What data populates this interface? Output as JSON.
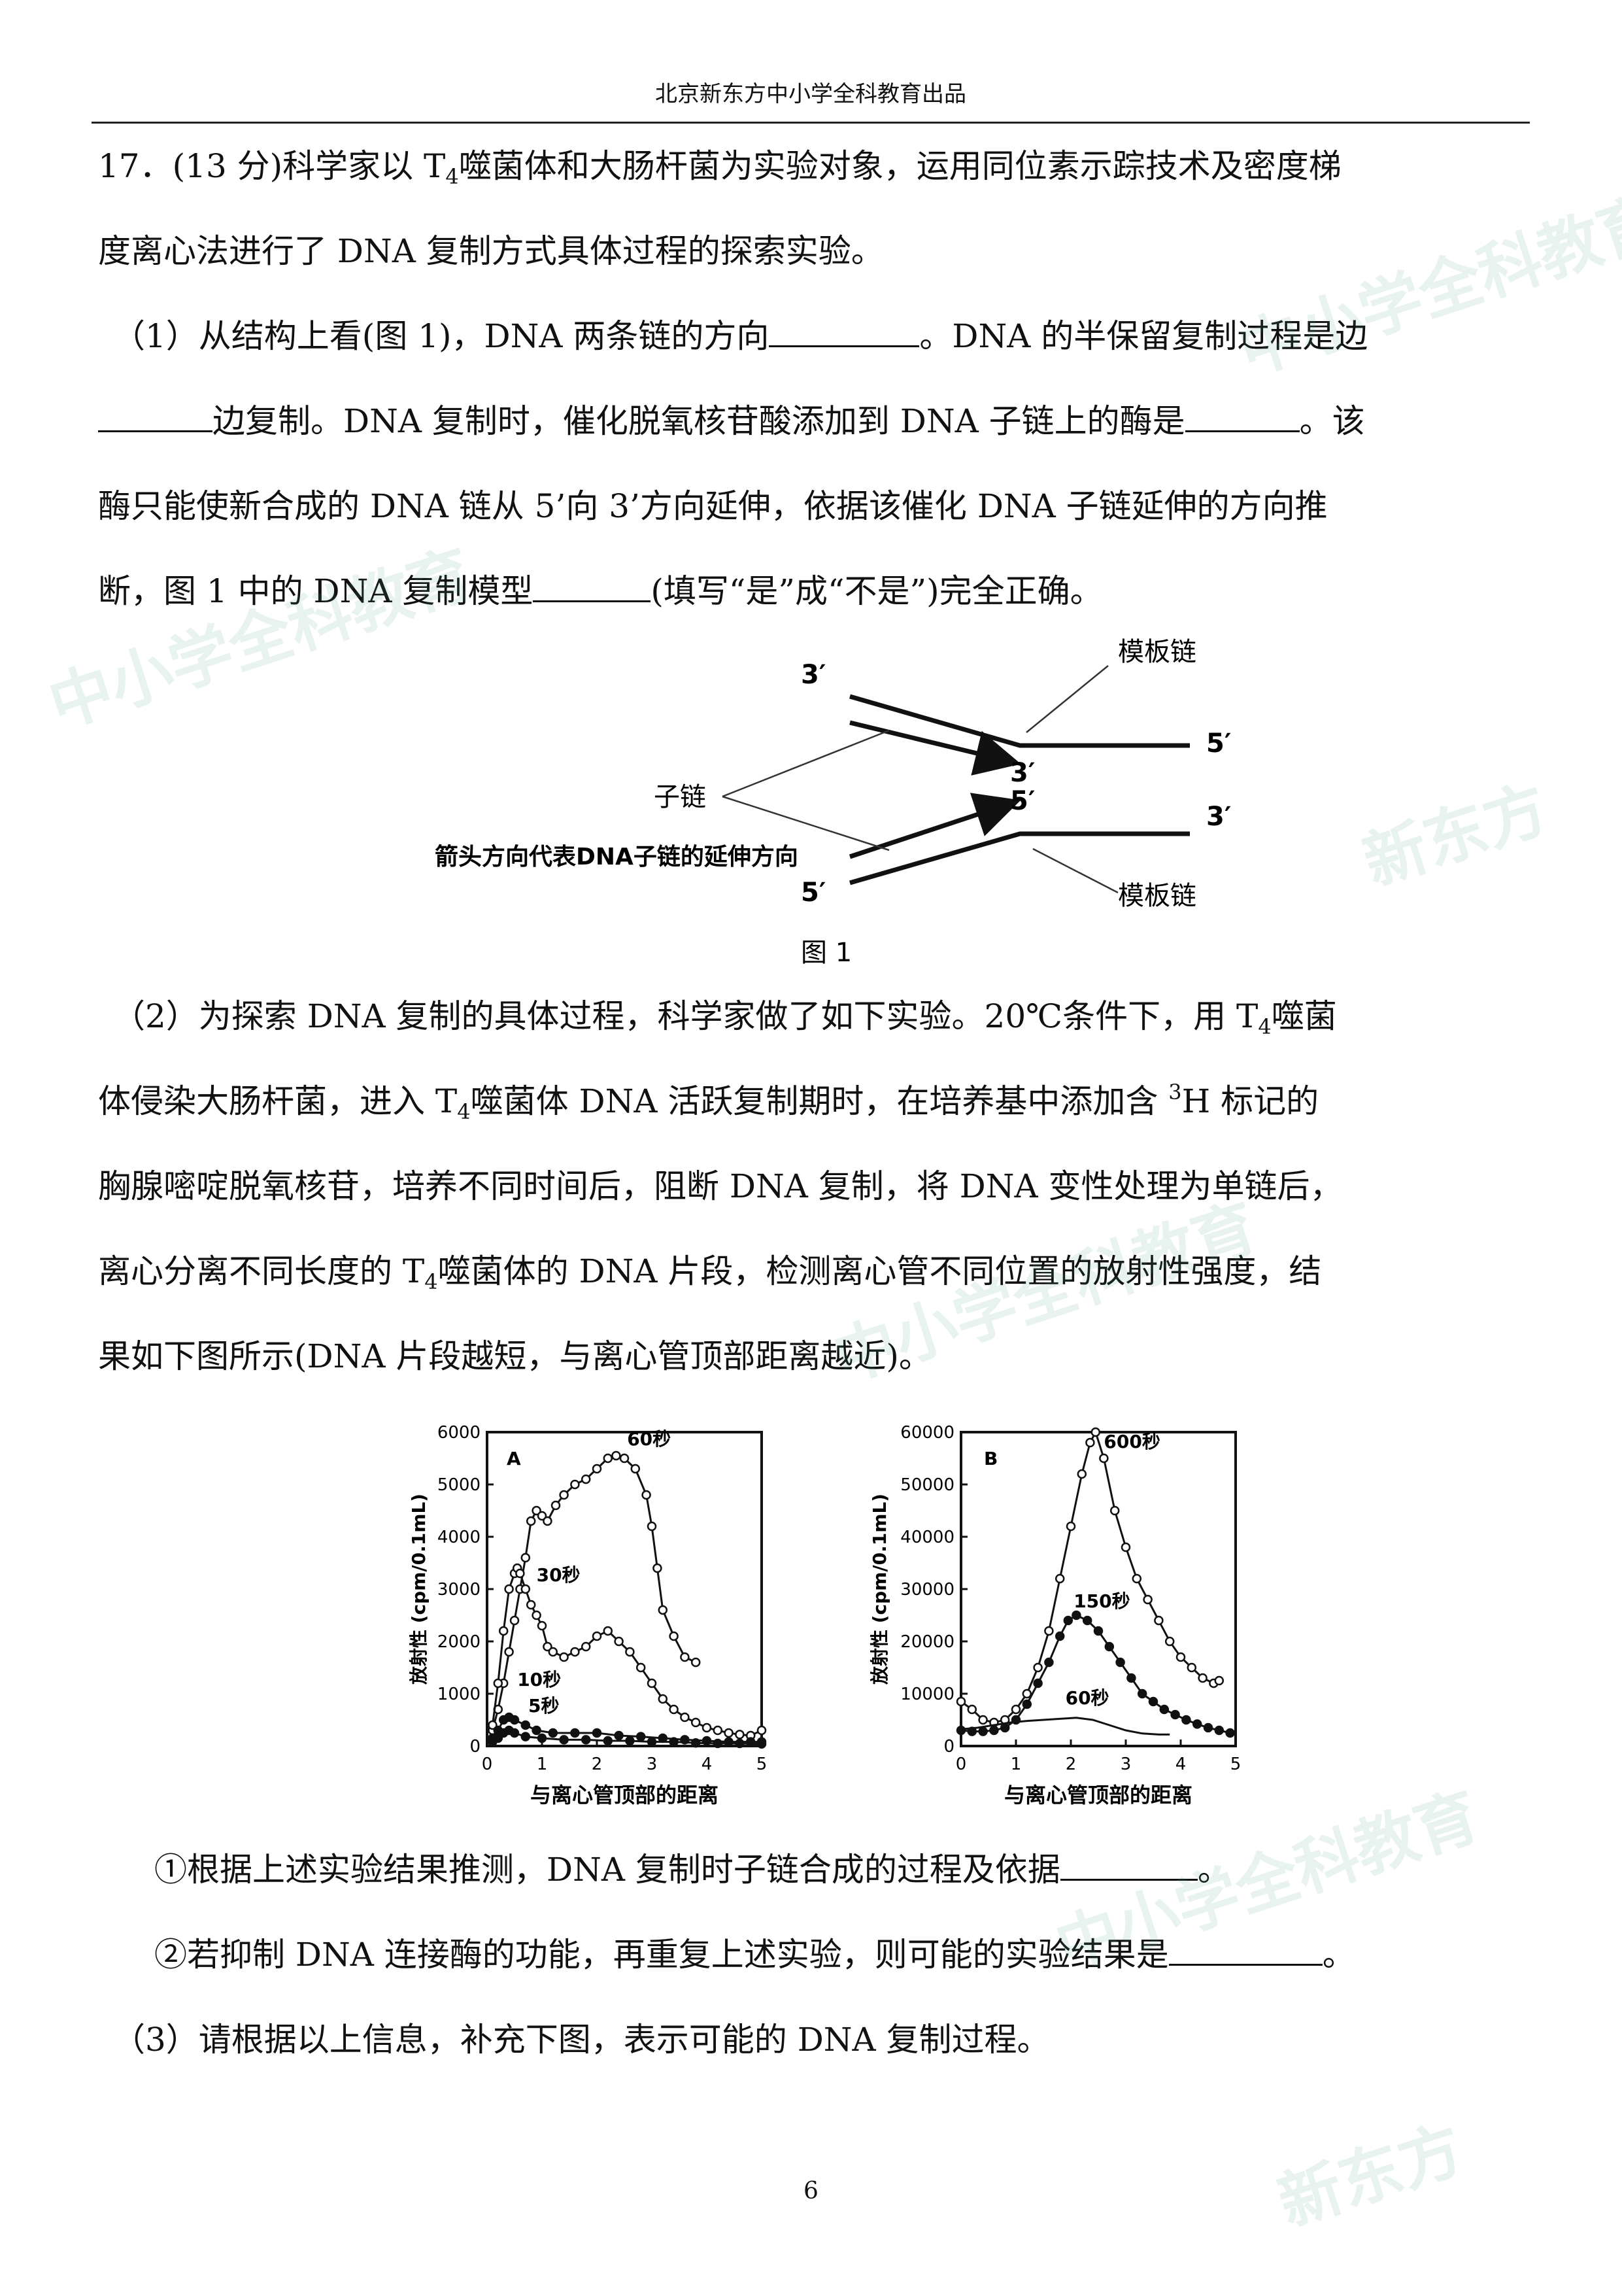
{
  "header": "北京新东方中小学全科教育出品",
  "question": {
    "title_prefix": "17．(13 分)科学家以 T",
    "title_sub": "4",
    "title_rest": "噬菌体和大肠杆菌为实验对象，运用同位素示踪技术及密度梯",
    "title_line2": "度离心法进行了 DNA 复制方式具体过程的探索实验。",
    "p1_l1a": "（1）从结构上看(图 1)，DNA 两条链的方向",
    "p1_l1b": "。DNA 的半保留复制过程是边",
    "p1_l2a": "边复制。DNA 复制时，催化脱氧核苷酸添加到 DNA 子链上的酶是",
    "p1_l2b": "。该",
    "p1_l3": "酶只能使新合成的 DNA 链从 5’向 3’方向延伸，依据该催化 DNA 子链延伸的方向推",
    "p1_l4a": "断，图 1 中的 DNA 复制模型",
    "p1_l4b": "(填写“是”成“不是”)完全正确。",
    "p2_l1a": "（2）为探索 DNA 复制的具体过程，科学家做了如下实验。20℃条件下，用 T",
    "p2_l1sub": "4",
    "p2_l1b": "噬菌",
    "p2_l2a": "体侵染大肠杆菌，进入 T",
    "p2_l2sub": "4",
    "p2_l2b": "噬菌体 DNA 活跃复制期时，在培养基中添加含 ",
    "p2_l2sup": "3",
    "p2_l2c": "H 标记的",
    "p2_l3": "胸腺嘧啶脱氧核苷，培养不同时间后，阻断 DNA 复制，将 DNA 变性处理为单链后，",
    "p2_l4a": "离心分离不同长度的 T",
    "p2_l4sub": "4",
    "p2_l4b": "噬菌体的 DNA 片段，检测离心管不同位置的放射性强度，结",
    "p2_l5": "果如下图所示(DNA 片段越短，与离心管顶部距离越近)。",
    "q1a": "①根据上述实验结果推测，DNA 复制时子链合成的过程及依据",
    "q1b": "。",
    "q2a": "②若抑制 DNA 连接酶的功能，再重复上述实验，则可能的实验结果是",
    "q2b": "。",
    "p3": "（3）请根据以上信息，补充下图，表示可能的 DNA 复制过程。"
  },
  "figure1": {
    "caption": "图 1",
    "labels": {
      "template_top": "模板链",
      "template_bottom": "模板链",
      "daughter": "子链",
      "arrow_note": "箭头方向代表DNA子链的延伸方向",
      "top_left": "3′",
      "inner_top": "3′",
      "right_top": "5′",
      "inner_bottom": "5′",
      "right_bottom": "3′",
      "bottom_left": "5′"
    }
  },
  "chart_data": [
    {
      "type": "line",
      "panel": "A",
      "xlabel": "与离心管顶部的距离",
      "ylabel": "放射性 (cpm/0.1mL)",
      "xlim": [
        0,
        5
      ],
      "ylim": [
        0,
        6000
      ],
      "xticks": [
        0,
        1,
        2,
        3,
        4,
        5
      ],
      "yticks": [
        0,
        1000,
        2000,
        3000,
        4000,
        5000,
        6000
      ],
      "series": [
        {
          "name": "60秒",
          "marker": "open-circle",
          "points": [
            [
              0.1,
              300
            ],
            [
              0.2,
              700
            ],
            [
              0.3,
              1200
            ],
            [
              0.4,
              1800
            ],
            [
              0.5,
              2400
            ],
            [
              0.6,
              3000
            ],
            [
              0.7,
              3600
            ],
            [
              0.8,
              4300
            ],
            [
              0.9,
              4500
            ],
            [
              1.0,
              4400
            ],
            [
              1.1,
              4300
            ],
            [
              1.25,
              4600
            ],
            [
              1.4,
              4800
            ],
            [
              1.6,
              5000
            ],
            [
              1.8,
              5100
            ],
            [
              2.0,
              5300
            ],
            [
              2.2,
              5500
            ],
            [
              2.35,
              5550
            ],
            [
              2.5,
              5500
            ],
            [
              2.7,
              5300
            ],
            [
              2.9,
              4800
            ],
            [
              3.0,
              4200
            ],
            [
              3.1,
              3400
            ],
            [
              3.2,
              2600
            ],
            [
              3.4,
              2100
            ],
            [
              3.6,
              1700
            ],
            [
              3.8,
              1600
            ]
          ]
        },
        {
          "name": "30秒",
          "marker": "open-circle",
          "points": [
            [
              0.1,
              400
            ],
            [
              0.2,
              1200
            ],
            [
              0.3,
              2200
            ],
            [
              0.4,
              3000
            ],
            [
              0.5,
              3300
            ],
            [
              0.55,
              3400
            ],
            [
              0.6,
              3300
            ],
            [
              0.7,
              3000
            ],
            [
              0.8,
              2700
            ],
            [
              0.9,
              2500
            ],
            [
              1.0,
              2300
            ],
            [
              1.1,
              1900
            ],
            [
              1.2,
              1800
            ],
            [
              1.4,
              1700
            ],
            [
              1.6,
              1800
            ],
            [
              1.8,
              1900
            ],
            [
              2.0,
              2100
            ],
            [
              2.2,
              2200
            ],
            [
              2.4,
              2000
            ],
            [
              2.6,
              1800
            ],
            [
              2.8,
              1500
            ],
            [
              3.0,
              1200
            ],
            [
              3.2,
              900
            ],
            [
              3.4,
              700
            ],
            [
              3.6,
              550
            ],
            [
              3.8,
              450
            ],
            [
              4.0,
              350
            ],
            [
              4.2,
              300
            ],
            [
              4.4,
              250
            ],
            [
              4.6,
              220
            ],
            [
              4.8,
              200
            ],
            [
              5.0,
              300
            ]
          ]
        },
        {
          "name": "10秒",
          "marker": "filled-circle",
          "points": [
            [
              0.1,
              150
            ],
            [
              0.2,
              300
            ],
            [
              0.3,
              500
            ],
            [
              0.4,
              550
            ],
            [
              0.5,
              500
            ],
            [
              0.7,
              400
            ],
            [
              0.9,
              300
            ],
            [
              1.2,
              250
            ],
            [
              1.6,
              250
            ],
            [
              2.0,
              250
            ],
            [
              2.4,
              200
            ],
            [
              2.8,
              180
            ],
            [
              3.2,
              150
            ],
            [
              3.6,
              120
            ],
            [
              4.0,
              100
            ],
            [
              4.4,
              80
            ],
            [
              4.8,
              80
            ],
            [
              5.0,
              80
            ]
          ]
        },
        {
          "name": "5秒",
          "marker": "filled-circle",
          "points": [
            [
              0.1,
              80
            ],
            [
              0.2,
              150
            ],
            [
              0.3,
              250
            ],
            [
              0.4,
              300
            ],
            [
              0.5,
              250
            ],
            [
              0.7,
              180
            ],
            [
              1.0,
              150
            ],
            [
              1.4,
              120
            ],
            [
              1.8,
              120
            ],
            [
              2.2,
              100
            ],
            [
              2.6,
              100
            ],
            [
              3.0,
              80
            ],
            [
              3.4,
              80
            ],
            [
              3.8,
              60
            ],
            [
              4.2,
              50
            ],
            [
              4.6,
              50
            ],
            [
              5.0,
              40
            ]
          ]
        }
      ]
    },
    {
      "type": "line",
      "panel": "B",
      "xlabel": "与离心管顶部的距离",
      "ylabel": "放射性 (cpm/0.1mL)",
      "xlim": [
        0,
        5
      ],
      "ylim": [
        0,
        60000
      ],
      "xticks": [
        0,
        1,
        2,
        3,
        4,
        5
      ],
      "yticks": [
        0,
        10000,
        20000,
        30000,
        40000,
        50000,
        60000
      ],
      "series": [
        {
          "name": "600秒",
          "marker": "open-circle",
          "points": [
            [
              0.0,
              8500
            ],
            [
              0.2,
              7000
            ],
            [
              0.4,
              5000
            ],
            [
              0.6,
              4500
            ],
            [
              0.8,
              5000
            ],
            [
              1.0,
              7000
            ],
            [
              1.2,
              10000
            ],
            [
              1.4,
              15000
            ],
            [
              1.6,
              22000
            ],
            [
              1.8,
              32000
            ],
            [
              2.0,
              42000
            ],
            [
              2.2,
              52000
            ],
            [
              2.35,
              58000
            ],
            [
              2.45,
              60000
            ],
            [
              2.6,
              55000
            ],
            [
              2.8,
              45000
            ],
            [
              3.0,
              38000
            ],
            [
              3.2,
              32000
            ],
            [
              3.4,
              28000
            ],
            [
              3.6,
              24000
            ],
            [
              3.8,
              20000
            ],
            [
              4.0,
              17000
            ],
            [
              4.2,
              15000
            ],
            [
              4.4,
              13000
            ],
            [
              4.6,
              12000
            ],
            [
              4.7,
              12500
            ]
          ]
        },
        {
          "name": "150秒",
          "marker": "filled-circle",
          "points": [
            [
              0.0,
              3000
            ],
            [
              0.2,
              2800
            ],
            [
              0.4,
              2800
            ],
            [
              0.6,
              3000
            ],
            [
              0.8,
              3500
            ],
            [
              1.0,
              5000
            ],
            [
              1.2,
              8000
            ],
            [
              1.4,
              12000
            ],
            [
              1.6,
              16000
            ],
            [
              1.8,
              21000
            ],
            [
              1.95,
              24000
            ],
            [
              2.1,
              25000
            ],
            [
              2.3,
              24000
            ],
            [
              2.5,
              22000
            ],
            [
              2.7,
              19000
            ],
            [
              2.9,
              16000
            ],
            [
              3.1,
              13000
            ],
            [
              3.3,
              10000
            ],
            [
              3.5,
              8500
            ],
            [
              3.7,
              7000
            ],
            [
              3.9,
              6000
            ],
            [
              4.1,
              5000
            ],
            [
              4.3,
              4200
            ],
            [
              4.5,
              3500
            ],
            [
              4.7,
              3000
            ],
            [
              4.9,
              2500
            ]
          ]
        },
        {
          "name": "60秒",
          "marker": "none",
          "points": [
            [
              0.0,
              3200
            ],
            [
              0.3,
              3500
            ],
            [
              0.6,
              4000
            ],
            [
              0.9,
              4500
            ],
            [
              1.2,
              4800
            ],
            [
              1.5,
              5000
            ],
            [
              1.8,
              5200
            ],
            [
              2.1,
              5400
            ],
            [
              2.4,
              5000
            ],
            [
              2.7,
              4000
            ],
            [
              3.0,
              3000
            ],
            [
              3.3,
              2400
            ],
            [
              3.6,
              2200
            ],
            [
              3.8,
              2200
            ]
          ]
        }
      ]
    }
  ],
  "page_number": "6",
  "watermarks": [
    "新东方",
    "中小学全科教育"
  ]
}
